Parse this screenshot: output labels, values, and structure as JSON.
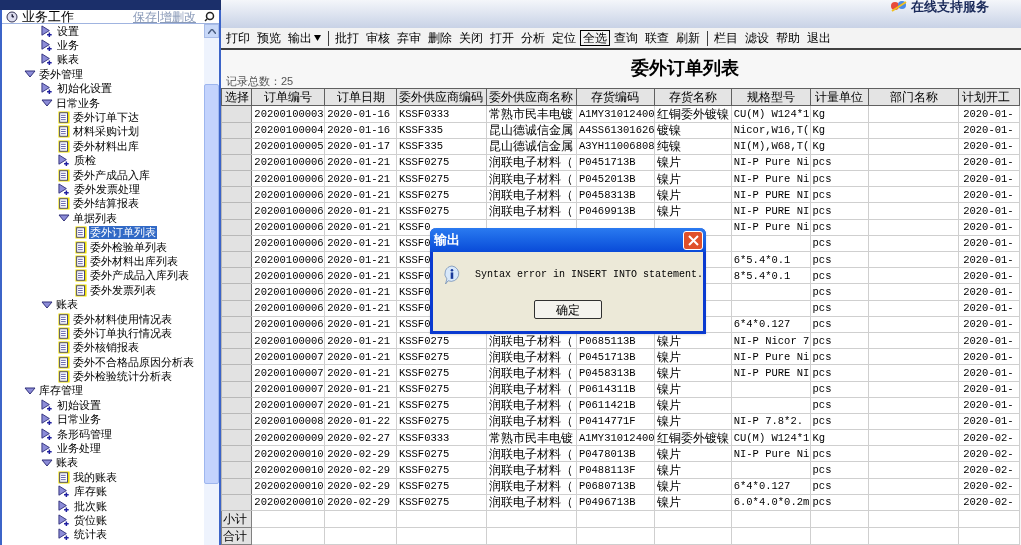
{
  "banner": {
    "support": "在线支持服务"
  },
  "sidebar": {
    "title": "业务工作",
    "actions": [
      "保存",
      "增删改"
    ],
    "tree": [
      {
        "children": [
          {
            "label": "设置",
            "kind": "folder",
            "expanded": false,
            "selected": false
          },
          {
            "label": "业务",
            "kind": "folder",
            "expanded": false,
            "selected": false
          },
          {
            "label": "账表",
            "kind": "folder",
            "expanded": false,
            "selected": false
          }
        ]
      },
      {
        "label": "委外管理",
        "kind": "folder",
        "expanded": true,
        "selected": false,
        "children": [
          {
            "label": "初始化设置",
            "kind": "folder",
            "expanded": false,
            "selected": false
          },
          {
            "label": "日常业务",
            "kind": "folder",
            "expanded": true,
            "selected": false,
            "children": [
              {
                "label": "委外订单下达",
                "kind": "report",
                "selected": false
              },
              {
                "label": "材料采购计划",
                "kind": "report",
                "selected": false
              },
              {
                "label": "委外材料出库",
                "kind": "report",
                "selected": false
              },
              {
                "label": "质检",
                "kind": "folder",
                "expanded": false,
                "selected": false
              },
              {
                "label": "委外产成品入库",
                "kind": "report",
                "selected": false
              },
              {
                "label": "委外发票处理",
                "kind": "folder",
                "expanded": false,
                "selected": false
              },
              {
                "label": "委外结算报表",
                "kind": "report",
                "selected": false
              },
              {
                "label": "单据列表",
                "kind": "folder",
                "expanded": true,
                "selected": false,
                "children": [
                  {
                    "label": "委外订单列表",
                    "kind": "report",
                    "selected": true
                  },
                  {
                    "label": "委外检验单列表",
                    "kind": "report",
                    "selected": false
                  },
                  {
                    "label": "委外材料出库列表",
                    "kind": "report",
                    "selected": false
                  },
                  {
                    "label": "委外产成品入库列表",
                    "kind": "report",
                    "selected": false
                  },
                  {
                    "label": "委外发票列表",
                    "kind": "report",
                    "selected": false
                  }
                ]
              }
            ]
          },
          {
            "label": "账表",
            "kind": "folder",
            "expanded": true,
            "selected": false,
            "children": [
              {
                "label": "委外材料使用情况表",
                "kind": "report",
                "selected": false
              },
              {
                "label": "委外订单执行情况表",
                "kind": "report",
                "selected": false
              },
              {
                "label": "委外核销报表",
                "kind": "report",
                "selected": false
              },
              {
                "label": "委外不合格品原因分析表",
                "kind": "report",
                "selected": false
              },
              {
                "label": "委外检验统计分析表",
                "kind": "report",
                "selected": false
              }
            ]
          }
        ]
      },
      {
        "label": "库存管理",
        "kind": "folder",
        "expanded": true,
        "selected": false,
        "children": [
          {
            "label": "初始设置",
            "kind": "folder",
            "expanded": false,
            "selected": false
          },
          {
            "label": "日常业务",
            "kind": "folder",
            "expanded": false,
            "selected": false
          },
          {
            "label": "条形码管理",
            "kind": "folder",
            "expanded": false,
            "selected": false
          },
          {
            "label": "业务处理",
            "kind": "folder",
            "expanded": false,
            "selected": false
          },
          {
            "label": "账表",
            "kind": "folder",
            "expanded": true,
            "selected": false,
            "children": [
              {
                "label": "我的账表",
                "kind": "report",
                "selected": false
              },
              {
                "label": "库存账",
                "kind": "folder",
                "expanded": false,
                "selected": false
              },
              {
                "label": "批次账",
                "kind": "folder",
                "expanded": false,
                "selected": false
              },
              {
                "label": "货位账",
                "kind": "folder",
                "expanded": false,
                "selected": false
              },
              {
                "label": "统计表",
                "kind": "folder",
                "expanded": false,
                "selected": false
              }
            ]
          }
        ]
      }
    ]
  },
  "toolbar": [
    [
      {
        "label": "打印",
        "focused": false,
        "menu": false
      },
      {
        "label": "预览",
        "focused": false,
        "menu": false
      },
      {
        "label": "输出",
        "focused": false,
        "menu": true
      }
    ],
    [
      {
        "label": "批打",
        "focused": false,
        "menu": false
      },
      {
        "label": "审核",
        "focused": false,
        "menu": false
      },
      {
        "label": "弃审",
        "focused": false,
        "menu": false
      },
      {
        "label": "删除",
        "focused": false,
        "menu": false
      },
      {
        "label": "关闭",
        "focused": false,
        "menu": false
      },
      {
        "label": "打开",
        "focused": false,
        "menu": false
      },
      {
        "label": "分析",
        "focused": false,
        "menu": false
      },
      {
        "label": "定位",
        "focused": false,
        "menu": false
      },
      {
        "label": "全选",
        "focused": true,
        "menu": false
      },
      {
        "label": "查询",
        "focused": false,
        "menu": false
      },
      {
        "label": "联查",
        "focused": false,
        "menu": false
      },
      {
        "label": "刷新",
        "focused": false,
        "menu": false
      }
    ],
    [
      {
        "label": "栏目",
        "focused": false,
        "menu": false
      },
      {
        "label": "滤设",
        "focused": false,
        "menu": false
      },
      {
        "label": "帮助",
        "focused": false,
        "menu": false
      },
      {
        "label": "退出",
        "focused": false,
        "menu": false
      }
    ]
  ],
  "report": {
    "title": "委外订单列表",
    "record_count": "记录总数：25",
    "columns": [
      "选择",
      "订单编号",
      "订单日期",
      "委外供应商编码",
      "委外供应商名称",
      "存货编码",
      "存货名称",
      "规格型号",
      "计量单位",
      "部门名称",
      "计划开工"
    ],
    "rows": [
      {
        "order_no": "20200100003",
        "date": "2020-01-16",
        "supplier_code": "KSSF0333",
        "supplier_name": "常熟市民丰电镀",
        "item_code": "A1MY31012400",
        "item_name": "红铜委外镀镍",
        "spec": "CU(M) W124*1",
        "unit": "Kg",
        "plan_start": "2020-01-"
      },
      {
        "order_no": "20200100004",
        "date": "2020-01-16",
        "supplier_code": "KSSF335",
        "supplier_name": "昆山德诚信金属",
        "item_code": "A4SS61301626",
        "item_name": "镀镍",
        "spec": "Nicor,W16,T(",
        "unit": "Kg",
        "plan_start": "2020-01-"
      },
      {
        "order_no": "20200100005",
        "date": "2020-01-17",
        "supplier_code": "KSSF335",
        "supplier_name": "昆山德诚信金属",
        "item_code": "A3YH11006808",
        "item_name": "纯镍",
        "spec": "NI(M),W68,T(",
        "unit": "Kg",
        "plan_start": "2020-01-"
      },
      {
        "order_no": "20200100006",
        "date": "2020-01-21",
        "supplier_code": "KSSF0275",
        "supplier_name": "润联电子材料（",
        "item_code": "P0451713B",
        "item_name": "镍片",
        "spec": "NI-P Pure Ni",
        "unit": "pcs",
        "plan_start": "2020-01-"
      },
      {
        "order_no": "20200100006",
        "date": "2020-01-21",
        "supplier_code": "KSSF0275",
        "supplier_name": "润联电子材料（",
        "item_code": "P0452013B",
        "item_name": "镍片",
        "spec": "NI-P Pure Ni",
        "unit": "pcs",
        "plan_start": "2020-01-"
      },
      {
        "order_no": "20200100006",
        "date": "2020-01-21",
        "supplier_code": "KSSF0275",
        "supplier_name": "润联电子材料（",
        "item_code": "P0458313B",
        "item_name": "镍片",
        "spec": "NI-P PURE NI",
        "unit": "pcs",
        "plan_start": "2020-01-"
      },
      {
        "order_no": "20200100006",
        "date": "2020-01-21",
        "supplier_code": "KSSF0275",
        "supplier_name": "润联电子材料（",
        "item_code": "P0469913B",
        "item_name": "镍片",
        "spec": "NI-P PURE NI",
        "unit": "pcs",
        "plan_start": "2020-01-"
      },
      {
        "order_no": "20200100006",
        "date": "2020-01-21",
        "supplier_code": "KSSF0",
        "spec": "NI-P Pure Ni",
        "unit": "pcs",
        "plan_start": "2020-01-"
      },
      {
        "order_no": "20200100006",
        "date": "2020-01-21",
        "supplier_code": "KSSF0",
        "unit": "pcs",
        "plan_start": "2020-01-"
      },
      {
        "order_no": "20200100006",
        "date": "2020-01-21",
        "supplier_code": "KSSF0",
        "spec": "6*5.4*0.1",
        "unit": "pcs",
        "plan_start": "2020-01-"
      },
      {
        "order_no": "20200100006",
        "date": "2020-01-21",
        "supplier_code": "KSSF0",
        "spec": "8*5.4*0.1",
        "unit": "pcs",
        "plan_start": "2020-01-"
      },
      {
        "order_no": "20200100006",
        "date": "2020-01-21",
        "supplier_code": "KSSF0",
        "unit": "pcs",
        "plan_start": "2020-01-"
      },
      {
        "order_no": "20200100006",
        "date": "2020-01-21",
        "supplier_code": "KSSF0",
        "unit": "pcs",
        "plan_start": "2020-01-"
      },
      {
        "order_no": "20200100006",
        "date": "2020-01-21",
        "supplier_code": "KSSF0",
        "spec": "6*4*0.127",
        "unit": "pcs",
        "plan_start": "2020-01-"
      },
      {
        "order_no": "20200100006",
        "date": "2020-01-21",
        "supplier_code": "KSSF0275",
        "supplier_name": "润联电子材料（",
        "item_code": "P0685113B",
        "item_name": "镍片",
        "spec": "NI-P Nicor 7",
        "unit": "pcs",
        "plan_start": "2020-01-"
      },
      {
        "order_no": "20200100007",
        "date": "2020-01-21",
        "supplier_code": "KSSF0275",
        "supplier_name": "润联电子材料（",
        "item_code": "P0451713B",
        "item_name": "镍片",
        "spec": "NI-P Pure Ni",
        "unit": "pcs",
        "plan_start": "2020-01-"
      },
      {
        "order_no": "20200100007",
        "date": "2020-01-21",
        "supplier_code": "KSSF0275",
        "supplier_name": "润联电子材料（",
        "item_code": "P0458313B",
        "item_name": "镍片",
        "spec": "NI-P PURE NI",
        "unit": "pcs",
        "plan_start": "2020-01-"
      },
      {
        "order_no": "20200100007",
        "date": "2020-01-21",
        "supplier_code": "KSSF0275",
        "supplier_name": "润联电子材料（",
        "item_code": "P0614311B",
        "item_name": "镍片",
        "unit": "pcs",
        "plan_start": "2020-01-"
      },
      {
        "order_no": "20200100007",
        "date": "2020-01-21",
        "supplier_code": "KSSF0275",
        "supplier_name": "润联电子材料（",
        "item_code": "P0611421B",
        "item_name": "镍片",
        "unit": "pcs",
        "plan_start": "2020-01-"
      },
      {
        "order_no": "20200100008",
        "date": "2020-01-22",
        "supplier_code": "KSSF0275",
        "supplier_name": "润联电子材料（",
        "item_code": "P0414771F",
        "item_name": "镍片",
        "spec": "NI-P  7.8*2.",
        "unit": "pcs",
        "plan_start": "2020-01-"
      },
      {
        "order_no": "20200200009",
        "date": "2020-02-27",
        "supplier_code": "KSSF0333",
        "supplier_name": "常熟市民丰电镀",
        "item_code": "A1MY31012400",
        "item_name": "红铜委外镀镍",
        "spec": "CU(M) W124*1",
        "unit": "Kg",
        "plan_start": "2020-02-"
      },
      {
        "order_no": "20200200010",
        "date": "2020-02-29",
        "supplier_code": "KSSF0275",
        "supplier_name": "润联电子材料（",
        "item_code": "P0478013B",
        "item_name": "镍片",
        "spec": "NI-P Pure Ni",
        "unit": "pcs",
        "plan_start": "2020-02-"
      },
      {
        "order_no": "20200200010",
        "date": "2020-02-29",
        "supplier_code": "KSSF0275",
        "supplier_name": "润联电子材料（",
        "item_code": "P0488113F",
        "item_name": "镍片",
        "unit": "pcs",
        "plan_start": "2020-02-"
      },
      {
        "order_no": "20200200010",
        "date": "2020-02-29",
        "supplier_code": "KSSF0275",
        "supplier_name": "润联电子材料（",
        "item_code": "P0680713B",
        "item_name": "镍片",
        "spec": "6*4*0.127",
        "unit": "pcs",
        "plan_start": "2020-02-"
      },
      {
        "order_no": "20200200010",
        "date": "2020-02-29",
        "supplier_code": "KSSF0275",
        "supplier_name": "润联电子材料（",
        "item_code": "P0496713B",
        "item_name": "镍片",
        "spec": "6.0*4.0*0.2m",
        "unit": "pcs",
        "plan_start": "2020-02-"
      }
    ],
    "footer_rows": [
      "小计",
      "合计"
    ]
  },
  "dialog": {
    "title": "输出",
    "message": "Syntax error in INSERT INTO statement.",
    "button": "确定"
  }
}
